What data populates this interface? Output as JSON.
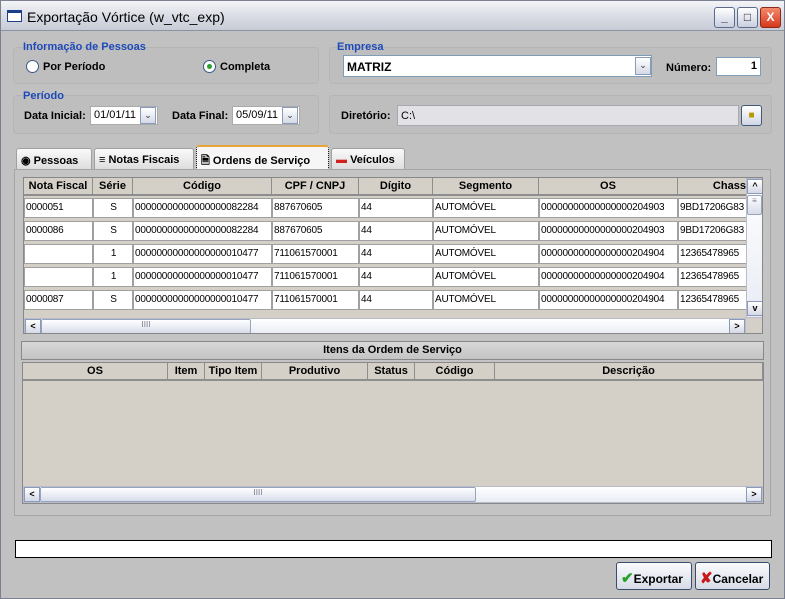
{
  "window": {
    "title": "Exportação Vórtice (w_vtc_exp)",
    "minimize": "_",
    "maximize": "□",
    "close": "X"
  },
  "pessoas": {
    "label": "Informação de Pessoas",
    "options": [
      {
        "label": "Por Período",
        "selected": false
      },
      {
        "label": "Completa",
        "selected": true
      }
    ]
  },
  "empresa": {
    "label": "Empresa",
    "value": "MATRIZ",
    "numero_label": "Número:",
    "numero_value": "1"
  },
  "periodo": {
    "label": "Período",
    "data_inicial_label": "Data Inicial:",
    "data_inicial": "01/01/11",
    "data_final_label": "Data Final:",
    "data_final": "05/09/11"
  },
  "diretorio": {
    "label": "Diretório:",
    "value": "C:\\"
  },
  "tabs": [
    {
      "label": "Pessoas",
      "icon": "person-icon"
    },
    {
      "label": "Notas Fiscais",
      "icon": "lines-icon"
    },
    {
      "label": "Ordens de Serviço",
      "icon": "document-icon",
      "active": true
    },
    {
      "label": "Veículos",
      "icon": "car-icon"
    }
  ],
  "os_table": {
    "columns": [
      "Nota Fiscal",
      "Série",
      "Código",
      "CPF / CNPJ",
      "Dígito",
      "Segmento",
      "OS",
      "Chassi"
    ],
    "rows": [
      [
        "0000051",
        "S",
        "00000000000000000082284",
        "887670605",
        "44",
        "AUTOMÓVEL",
        "00000000000000000204903",
        "9BD17206G83"
      ],
      [
        "0000086",
        "S",
        "00000000000000000082284",
        "887670605",
        "44",
        "AUTOMÓVEL",
        "00000000000000000204903",
        "9BD17206G83"
      ],
      [
        "",
        "1",
        "00000000000000000010477",
        "711061570001",
        "44",
        "AUTOMÓVEL",
        "00000000000000000204904",
        "12365478965"
      ],
      [
        "",
        "1",
        "00000000000000000010477",
        "711061570001",
        "44",
        "AUTOMÓVEL",
        "00000000000000000204904",
        "12365478965"
      ],
      [
        "0000087",
        "S",
        "00000000000000000010477",
        "711061570001",
        "44",
        "AUTOMÓVEL",
        "00000000000000000204904",
        "12365478965"
      ]
    ]
  },
  "itens": {
    "title": "Itens da Ordem de Serviço",
    "columns": [
      "OS",
      "Item",
      "Tipo Item",
      "Produtivo",
      "Status",
      "Código",
      "Descrição"
    ]
  },
  "status_text": "",
  "buttons": {
    "exportar": "Exportar",
    "cancelar": "Cancelar"
  }
}
